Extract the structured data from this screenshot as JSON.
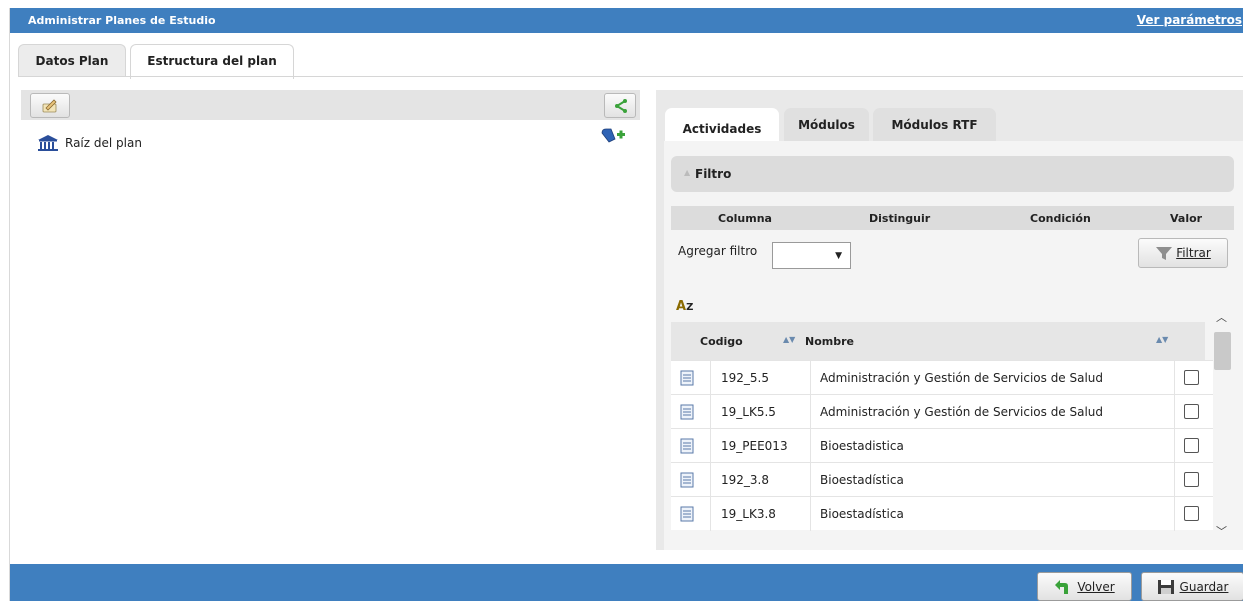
{
  "window": {
    "title": "Administrar Planes de Estudio",
    "params_link": "Ver parámetros"
  },
  "tabs": [
    {
      "label": "Datos Plan"
    },
    {
      "label": "Estructura del plan"
    }
  ],
  "tree": {
    "root_label": "Raíz del plan"
  },
  "right_tabs": [
    {
      "label": "Actividades"
    },
    {
      "label": "Módulos"
    },
    {
      "label": "Módulos RTF"
    }
  ],
  "filter": {
    "title": "Filtro",
    "columns": [
      "Columna",
      "Distinguir",
      "Condición",
      "Valor"
    ],
    "add_label": "Agregar filtro",
    "add_selected": "",
    "filter_button": "Filtrar"
  },
  "grid": {
    "sort_label": "Z",
    "columns": {
      "codigo": "Codigo",
      "nombre": "Nombre"
    },
    "rows": [
      {
        "codigo": "192_5.5",
        "nombre": "Administración y Gestión de Servicios de Salud"
      },
      {
        "codigo": "19_LK5.5",
        "nombre": "Administración y Gestión de Servicios de Salud"
      },
      {
        "codigo": "19_PEE013",
        "nombre": "Bioestadistica"
      },
      {
        "codigo": "192_3.8",
        "nombre": "Bioestadística"
      },
      {
        "codigo": "19_LK3.8",
        "nombre": "Bioestadística"
      }
    ]
  },
  "footer": {
    "back_label": "Volver",
    "save_label": "Guardar"
  },
  "colors": {
    "header": "#3f7fbf",
    "panel": "#e9e9e9",
    "accent_green": "#3aa23a"
  },
  "icons": [
    "edit-icon",
    "tree-expand-icon",
    "institution-icon",
    "add-node-icon",
    "funnel-icon",
    "sort-az-icon",
    "document-icon",
    "back-arrow-icon",
    "save-icon"
  ]
}
